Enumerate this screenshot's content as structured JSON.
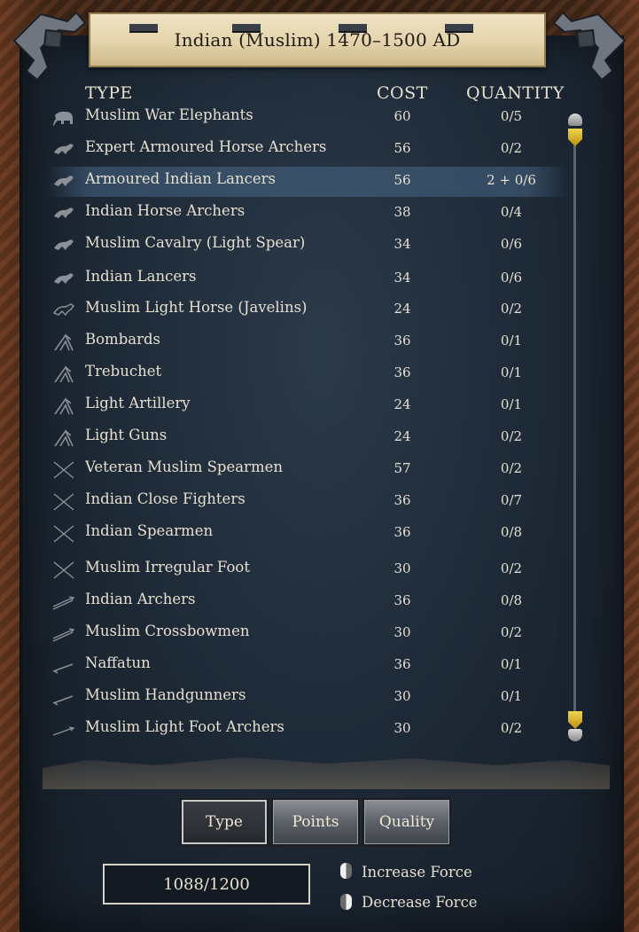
{
  "title": "Indian (Muslim) 1470–1500 AD",
  "headers": {
    "type": "TYPE",
    "cost": "COST",
    "quantity": "QUANTITY"
  },
  "units": [
    {
      "icon": "elephant-icon",
      "name": "Muslim War Elephants",
      "cost": "60",
      "qty": "0/5"
    },
    {
      "icon": "horse-icon",
      "name": "Expert Armoured Horse Archers",
      "cost": "56",
      "qty": "0/2"
    },
    {
      "icon": "horse-icon",
      "name": "Armoured Indian Lancers",
      "cost": "56",
      "qty": "2 + 0/6",
      "highlighted": true
    },
    {
      "icon": "horse-icon",
      "name": "Indian Horse Archers",
      "cost": "38",
      "qty": "0/4"
    },
    {
      "icon": "horse-icon",
      "name": "Muslim Cavalry (Light Spear)",
      "cost": "34",
      "qty": "0/6"
    },
    {
      "icon": "horse-icon",
      "name": "Indian Lancers",
      "cost": "34",
      "qty": "0/6"
    },
    {
      "icon": "light-horse-icon",
      "name": "Muslim Light Horse (Javelins)",
      "cost": "24",
      "qty": "0/2"
    },
    {
      "icon": "artillery-icon",
      "name": "Bombards",
      "cost": "36",
      "qty": "0/1"
    },
    {
      "icon": "artillery-icon",
      "name": "Trebuchet",
      "cost": "36",
      "qty": "0/1"
    },
    {
      "icon": "artillery-icon",
      "name": "Light Artillery",
      "cost": "24",
      "qty": "0/1"
    },
    {
      "icon": "artillery-icon",
      "name": "Light Guns",
      "cost": "24",
      "qty": "0/2"
    },
    {
      "icon": "crossed-spears-icon",
      "name": "Veteran Muslim Spearmen",
      "cost": "57",
      "qty": "0/2"
    },
    {
      "icon": "crossed-spears-icon",
      "name": "Indian Close Fighters",
      "cost": "36",
      "qty": "0/7"
    },
    {
      "icon": "crossed-spears-icon",
      "name": "Indian Spearmen",
      "cost": "36",
      "qty": "0/8"
    },
    {
      "icon": "crossed-spears-icon",
      "name": "Muslim Irregular Foot",
      "cost": "30",
      "qty": "0/2"
    },
    {
      "icon": "arrows-icon",
      "name": "Indian Archers",
      "cost": "36",
      "qty": "0/8"
    },
    {
      "icon": "arrows-icon",
      "name": "Muslim Crossbowmen",
      "cost": "30",
      "qty": "0/2"
    },
    {
      "icon": "gun-icon",
      "name": "Naffatun",
      "cost": "36",
      "qty": "0/1"
    },
    {
      "icon": "gun-icon",
      "name": "Muslim Handgunners",
      "cost": "30",
      "qty": "0/1"
    },
    {
      "icon": "arrow-icon",
      "name": "Muslim Light Foot Archers",
      "cost": "30",
      "qty": "0/2"
    }
  ],
  "sort_tabs": [
    {
      "label": "Type",
      "active": true
    },
    {
      "label": "Points",
      "active": false
    },
    {
      "label": "Quality",
      "active": false
    }
  ],
  "force_points": "1088/1200",
  "hints": {
    "increase": "Increase Force",
    "decrease": "Decrease Force"
  },
  "colors": {
    "panel": "#1d2835",
    "parchment": "#e4d3ab",
    "text": "#e6e0cf",
    "scroll_thumb": "#f1d44d"
  }
}
